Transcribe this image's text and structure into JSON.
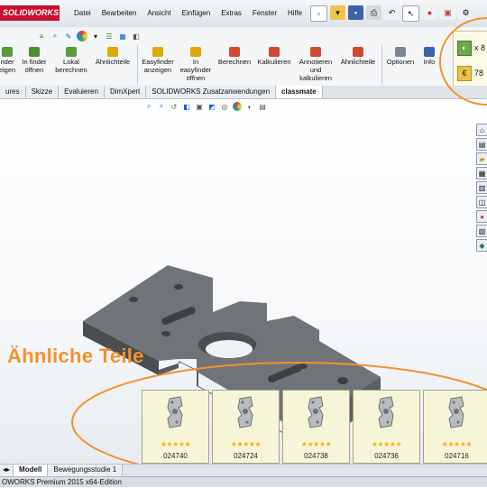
{
  "app": {
    "logo": "SOLIDWORKS"
  },
  "menu": [
    "Datei",
    "Bearbeiten",
    "Ansicht",
    "Einfügen",
    "Extras",
    "Fenster",
    "Hilfe"
  ],
  "commands": [
    {
      "label": "nder\neigen"
    },
    {
      "label": "In finder\nöffnen"
    },
    {
      "label": "Lokal\nberechnen"
    },
    {
      "label": "Ähnlichteile"
    },
    {
      "label": "Easyfinder\nanzeigen"
    },
    {
      "label": "In\neasyfinder\nöffnen"
    },
    {
      "label": "Berechnen"
    },
    {
      "label": "Kalkulieren"
    },
    {
      "label": "Annotieren\nund\nkalkulieren"
    },
    {
      "label": "Ähnlichteile"
    },
    {
      "label": "Optionen"
    },
    {
      "label": "Info"
    }
  ],
  "price_panel": {
    "row1": "x 8",
    "row2": "78",
    "currency_symbol": "€"
  },
  "tabs": [
    "ures",
    "Skizze",
    "Evaluieren",
    "DimXpert",
    "SOLIDWORKS Zusatzanwendungen",
    "classmate"
  ],
  "active_tab": "classmate",
  "similar_parts": {
    "title": "Ähnliche Teile",
    "items": [
      {
        "id": "024740",
        "stars": "★★★★★"
      },
      {
        "id": "024724",
        "stars": "★★★★★"
      },
      {
        "id": "024738",
        "stars": "★★★★★"
      },
      {
        "id": "024736",
        "stars": "★★★★★"
      },
      {
        "id": "024716",
        "stars": "★★★★★"
      }
    ]
  },
  "bottom_tabs": [
    "Modell",
    "Bewegungsstudie 1"
  ],
  "status": "OWORKS Premium 2015 x64-Edition",
  "colors": {
    "accent": "#f2922c",
    "logo": "#c8102e",
    "part": "#6e7275"
  }
}
